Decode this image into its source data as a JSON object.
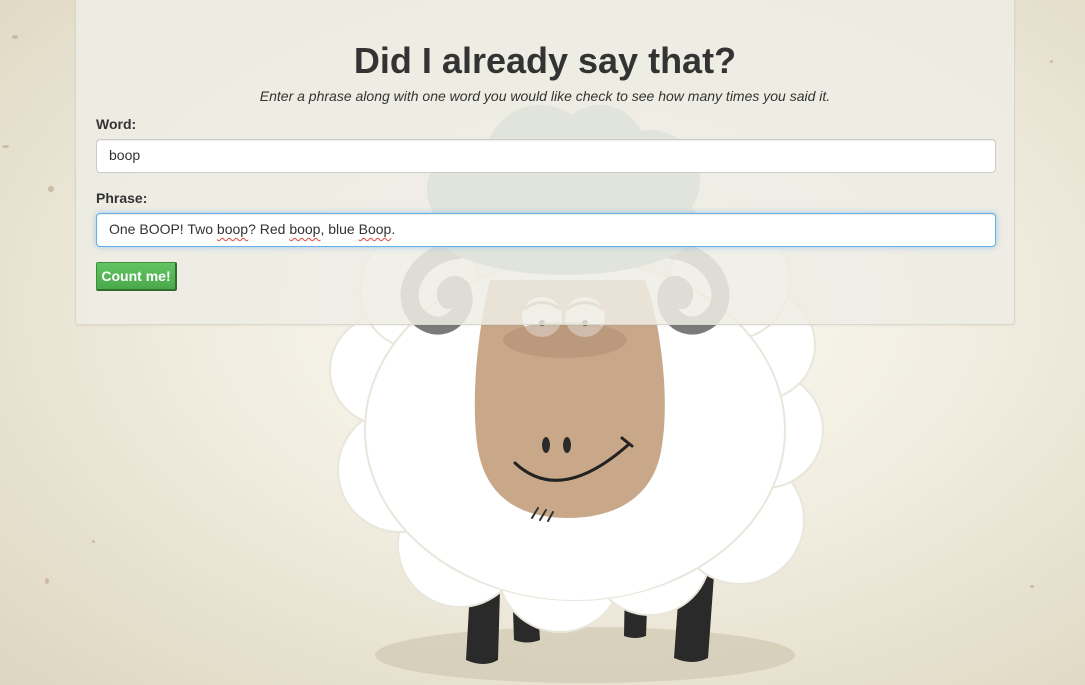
{
  "header": {
    "title": "Did I already say that?",
    "subtitle": "Enter a phrase along with one word you would like check to see how many times you said it."
  },
  "form": {
    "word_label": "Word:",
    "word_value": "boop",
    "phrase_label": "Phrase:",
    "phrase_parts": [
      "One BOOP! Two ",
      "boop",
      "? Red ",
      "boop",
      ", blue ",
      "Boop",
      "."
    ],
    "submit_label": "Count me!"
  },
  "colors": {
    "button_green": "#5cb85c",
    "focus_blue": "#66afe9",
    "sheep_face": "#c9a88a",
    "sheep_hair": "#96b0b2",
    "sheep_wool": "#ffffff"
  },
  "illustration": {
    "subject": "cartoon-sheep"
  }
}
